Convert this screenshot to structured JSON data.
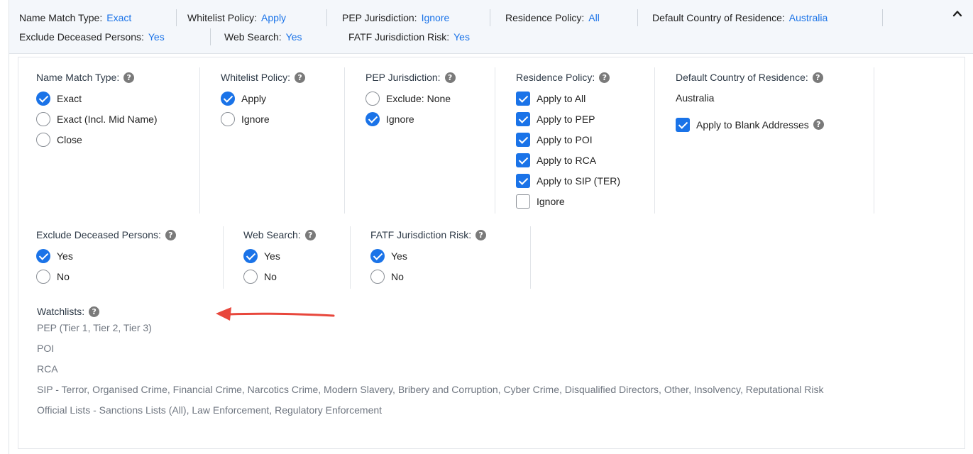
{
  "summary": {
    "name_match_label": "Name Match Type:",
    "name_match_value": "Exact",
    "whitelist_label": "Whitelist Policy:",
    "whitelist_value": "Apply",
    "pep_label": "PEP Jurisdiction:",
    "pep_value": "Ignore",
    "residence_label": "Residence Policy:",
    "residence_value": "All",
    "country_label": "Default Country of Residence:",
    "country_value": "Australia",
    "deceased_label": "Exclude Deceased Persons:",
    "deceased_value": "Yes",
    "web_label": "Web Search:",
    "web_value": "Yes",
    "fatf_label": "FATF Jurisdiction Risk:",
    "fatf_value": "Yes",
    "collapse_icon": "chevron-up-icon"
  },
  "name_match": {
    "title": "Name Match Type:",
    "options": [
      "Exact",
      "Exact (Incl. Mid Name)",
      "Close"
    ],
    "selected": "Exact"
  },
  "whitelist": {
    "title": "Whitelist Policy:",
    "options": [
      "Apply",
      "Ignore"
    ],
    "selected": "Apply"
  },
  "pep": {
    "title": "PEP Jurisdiction:",
    "options": [
      "Exclude: None",
      "Ignore"
    ],
    "selected": "Ignore"
  },
  "residence": {
    "title": "Residence Policy:",
    "options": [
      "Apply to All",
      "Apply to PEP",
      "Apply to POI",
      "Apply to RCA",
      "Apply to SIP (TER)",
      "Ignore"
    ],
    "checked": [
      true,
      true,
      true,
      true,
      true,
      false
    ]
  },
  "country": {
    "title": "Default Country of Residence:",
    "value": "Australia",
    "blank_label": "Apply to Blank Addresses",
    "blank_checked": true
  },
  "deceased": {
    "title": "Exclude Deceased Persons:",
    "options": [
      "Yes",
      "No"
    ],
    "selected": "Yes"
  },
  "web": {
    "title": "Web Search:",
    "options": [
      "Yes",
      "No"
    ],
    "selected": "Yes"
  },
  "fatf": {
    "title": "FATF Jurisdiction Risk:",
    "options": [
      "Yes",
      "No"
    ],
    "selected": "Yes"
  },
  "watchlists": {
    "title": "Watchlists:",
    "items": [
      "PEP (Tier 1, Tier 2, Tier 3)",
      "POI",
      "RCA",
      "SIP - Terror, Organised Crime, Financial Crime, Narcotics Crime, Modern Slavery, Bribery and Corruption, Cyber Crime, Disqualified Directors, Other, Insolvency, Reputational Risk",
      "Official Lists - Sanctions Lists (All), Law Enforcement, Regulatory Enforcement"
    ]
  },
  "help_glyph": "?",
  "colors": {
    "accent": "#1a73e8",
    "annotation_arrow": "#e8473c",
    "summary_bg": "#f4f7fb",
    "muted_text": "#6f7680"
  }
}
